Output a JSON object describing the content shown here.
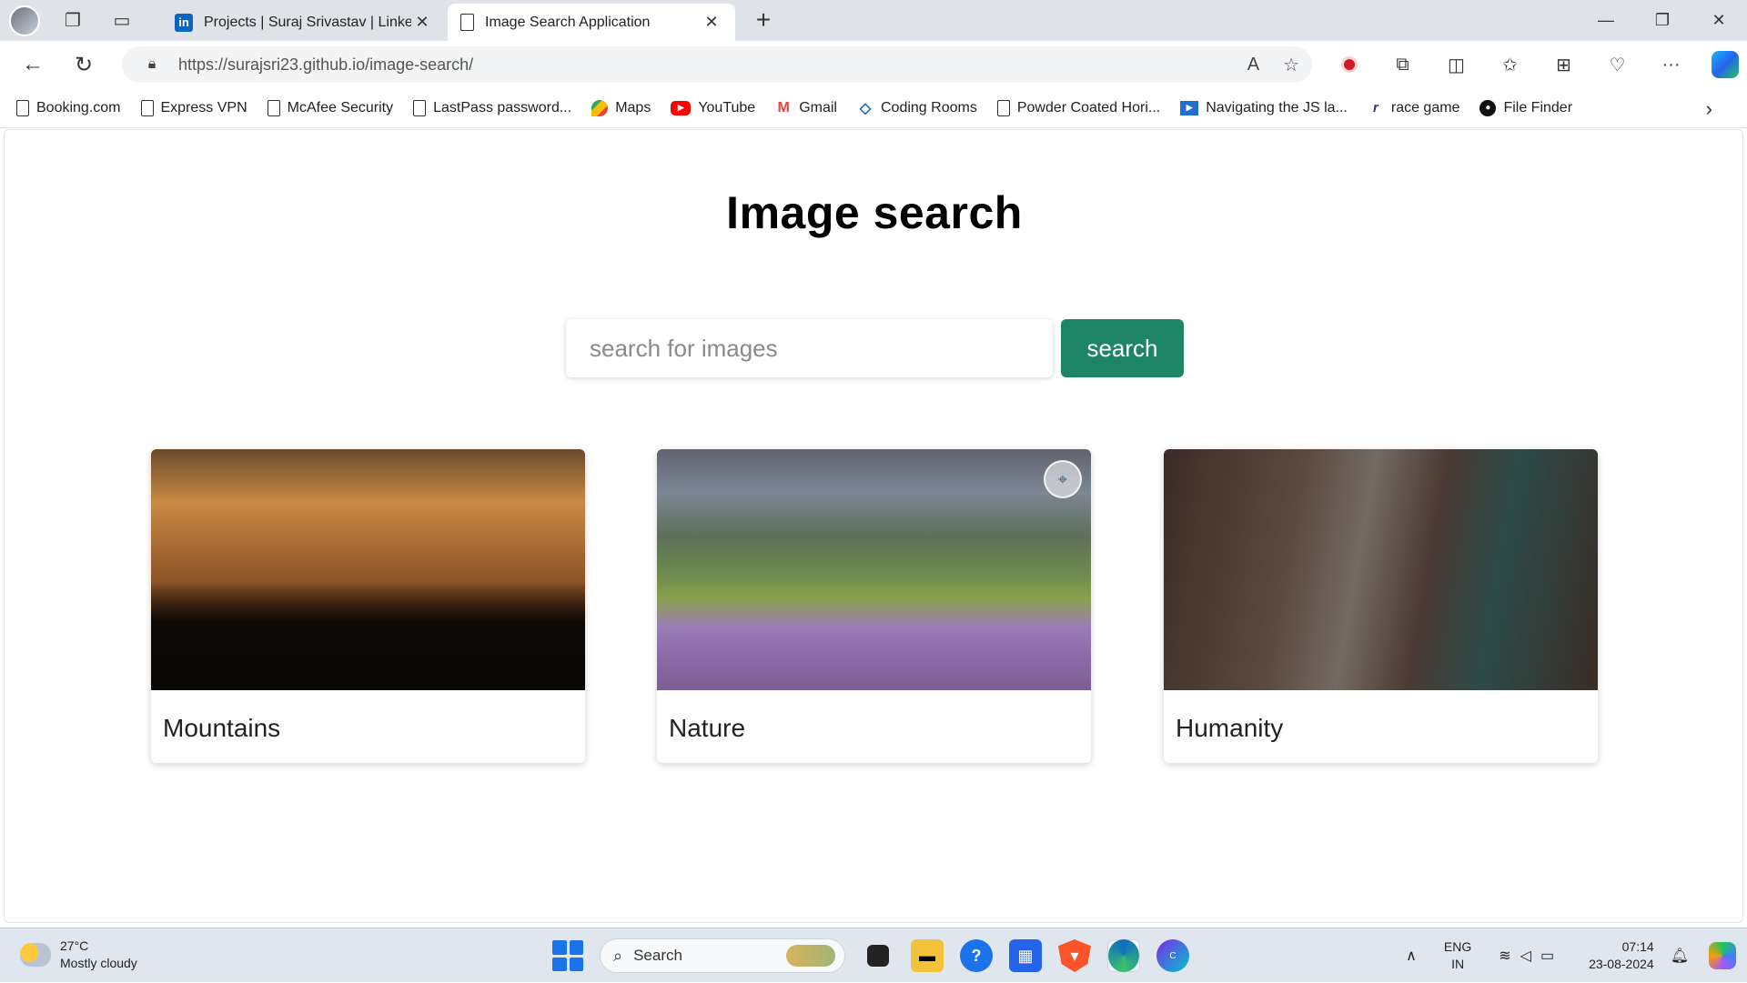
{
  "browser": {
    "tabs": [
      {
        "title": "Projects | Suraj Srivastav | LinkedIn",
        "icon": "linkedin-icon"
      },
      {
        "title": "Image Search Application",
        "icon": "page-icon"
      }
    ],
    "url_host": "https://surajsri23.github.io",
    "url_path": "/image-search/",
    "bookmarks": [
      {
        "label": "Booking.com",
        "icon": "page-icon"
      },
      {
        "label": "Express VPN",
        "icon": "page-icon"
      },
      {
        "label": "McAfee Security",
        "icon": "page-icon"
      },
      {
        "label": "LastPass password...",
        "icon": "page-icon"
      },
      {
        "label": "Maps",
        "icon": "maps-icon"
      },
      {
        "label": "YouTube",
        "icon": "youtube-icon"
      },
      {
        "label": "Gmail",
        "icon": "gmail-icon"
      },
      {
        "label": "Coding Rooms",
        "icon": "coding-rooms-icon"
      },
      {
        "label": "Powder Coated Hori...",
        "icon": "page-icon"
      },
      {
        "label": "Navigating the JS la...",
        "icon": "video-icon"
      },
      {
        "label": "race game",
        "icon": "race-game-icon"
      },
      {
        "label": "File Finder",
        "icon": "github-icon"
      }
    ]
  },
  "page": {
    "title": "Image search",
    "search_placeholder": "search for images",
    "search_button": "search",
    "accent_color": "#1d8466",
    "cards": [
      {
        "caption": "Mountains"
      },
      {
        "caption": "Nature"
      },
      {
        "caption": "Humanity"
      }
    ]
  },
  "taskbar": {
    "weather_temp": "27°C",
    "weather_desc": "Mostly cloudy",
    "search_label": "Search",
    "lang_line1": "ENG",
    "lang_line2": "IN",
    "time": "07:14",
    "date": "23-08-2024"
  }
}
